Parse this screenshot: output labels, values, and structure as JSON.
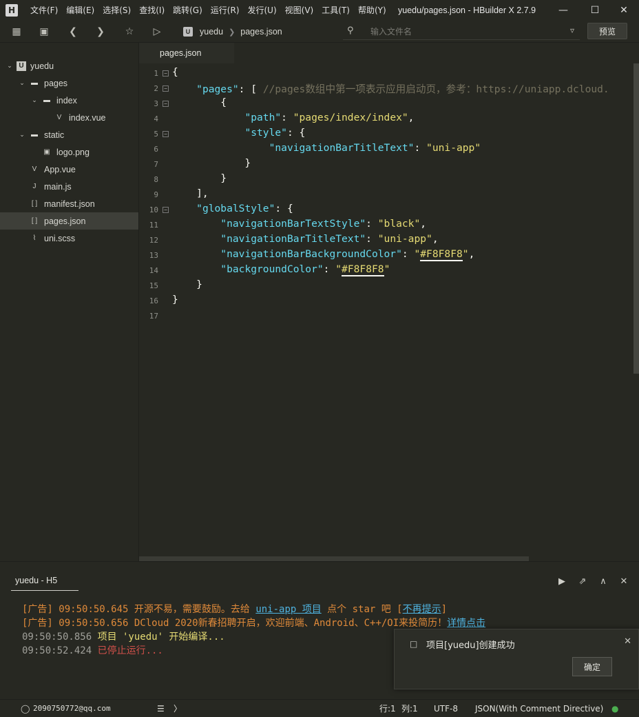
{
  "app": {
    "logo_letter": "H",
    "window_title": "yuedu/pages.json - HBuilder X 2.7.9",
    "menu": [
      "文件(F)",
      "编辑(E)",
      "选择(S)",
      "查找(I)",
      "跳转(G)",
      "运行(R)",
      "发行(U)",
      "视图(V)",
      "工具(T)",
      "帮助(Y)"
    ]
  },
  "toolbar": {
    "breadcrumb": [
      "yuedu",
      "pages.json"
    ],
    "project_badge": "U",
    "search_placeholder": "输入文件名",
    "preview_label": "预览"
  },
  "sidebar": {
    "tree": [
      {
        "label": "yuedu",
        "icon": "project-icon",
        "twisty": "open",
        "selected": false
      },
      {
        "label": "pages",
        "icon": "folder-icon",
        "twisty": "open",
        "selected": false
      },
      {
        "label": "index",
        "icon": "folder-icon",
        "twisty": "open",
        "selected": false
      },
      {
        "label": "index.vue",
        "icon": "vue-file-icon",
        "twisty": "none",
        "selected": false
      },
      {
        "label": "static",
        "icon": "folder-icon",
        "twisty": "open",
        "selected": false
      },
      {
        "label": "logo.png",
        "icon": "image-file-icon",
        "twisty": "none",
        "selected": false
      },
      {
        "label": "App.vue",
        "icon": "vue-file-icon",
        "twisty": "none",
        "selected": false
      },
      {
        "label": "main.js",
        "icon": "js-file-icon",
        "twisty": "none",
        "selected": false
      },
      {
        "label": "manifest.json",
        "icon": "json-file-icon",
        "twisty": "none",
        "selected": false
      },
      {
        "label": "pages.json",
        "icon": "json-file-icon",
        "twisty": "none",
        "selected": true
      },
      {
        "label": "uni.scss",
        "icon": "scss-file-icon",
        "twisty": "none",
        "selected": false
      }
    ]
  },
  "editor": {
    "tab_label": "pages.json",
    "lines": [
      [
        {
          "t": "{",
          "c": "p"
        }
      ],
      [
        {
          "t": "    ",
          "c": "p"
        },
        {
          "t": "\"pages\"",
          "c": "k"
        },
        {
          "t": ": [ ",
          "c": "p"
        },
        {
          "t": "//pages数组中第一项表示应用启动页，参考：https://uniapp.dcloud.",
          "c": "c"
        }
      ],
      [
        {
          "t": "        {",
          "c": "p"
        }
      ],
      [
        {
          "t": "            ",
          "c": "p"
        },
        {
          "t": "\"path\"",
          "c": "k"
        },
        {
          "t": ": ",
          "c": "p"
        },
        {
          "t": "\"pages/index/index\"",
          "c": "s"
        },
        {
          "t": ",",
          "c": "p"
        }
      ],
      [
        {
          "t": "            ",
          "c": "p"
        },
        {
          "t": "\"style\"",
          "c": "k"
        },
        {
          "t": ": {",
          "c": "p"
        }
      ],
      [
        {
          "t": "                ",
          "c": "p"
        },
        {
          "t": "\"navigationBarTitleText\"",
          "c": "k"
        },
        {
          "t": ": ",
          "c": "p"
        },
        {
          "t": "\"uni-app\"",
          "c": "s"
        }
      ],
      [
        {
          "t": "            }",
          "c": "p"
        }
      ],
      [
        {
          "t": "        }",
          "c": "p"
        }
      ],
      [
        {
          "t": "    ],",
          "c": "p"
        }
      ],
      [
        {
          "t": "    ",
          "c": "p"
        },
        {
          "t": "\"globalStyle\"",
          "c": "k"
        },
        {
          "t": ": {",
          "c": "p"
        }
      ],
      [
        {
          "t": "        ",
          "c": "p"
        },
        {
          "t": "\"navigationBarTextStyle\"",
          "c": "k"
        },
        {
          "t": ": ",
          "c": "p"
        },
        {
          "t": "\"black\"",
          "c": "s"
        },
        {
          "t": ",",
          "c": "p"
        }
      ],
      [
        {
          "t": "        ",
          "c": "p"
        },
        {
          "t": "\"navigationBarTitleText\"",
          "c": "k"
        },
        {
          "t": ": ",
          "c": "p"
        },
        {
          "t": "\"uni-app\"",
          "c": "s"
        },
        {
          "t": ",",
          "c": "p"
        }
      ],
      [
        {
          "t": "        ",
          "c": "p"
        },
        {
          "t": "\"navigationBarBackgroundColor\"",
          "c": "k"
        },
        {
          "t": ": ",
          "c": "p"
        },
        {
          "t": "\"",
          "c": "s"
        },
        {
          "t": "#F8F8F8",
          "c": "s hl"
        },
        {
          "t": "\"",
          "c": "s"
        },
        {
          "t": ",",
          "c": "p"
        }
      ],
      [
        {
          "t": "        ",
          "c": "p"
        },
        {
          "t": "\"backgroundColor\"",
          "c": "k"
        },
        {
          "t": ": ",
          "c": "p"
        },
        {
          "t": "\"",
          "c": "s"
        },
        {
          "t": "#F8F8F8",
          "c": "s hl"
        },
        {
          "t": "\"",
          "c": "s"
        }
      ],
      [
        {
          "t": "    }",
          "c": "p"
        }
      ],
      [
        {
          "t": "}",
          "c": "p"
        }
      ],
      [
        {
          "t": "",
          "c": "p"
        }
      ]
    ],
    "folds": [
      1,
      2,
      3,
      5,
      10
    ]
  },
  "console": {
    "tab_label": "yuedu - H5",
    "lines": [
      [
        {
          "t": "[广告] ",
          "c": "ad"
        },
        {
          "t": "09:50:50.645 ",
          "c": "ad"
        },
        {
          "t": "开源不易，需要鼓励。去给 ",
          "c": "ad"
        },
        {
          "t": "uni-app 项目",
          "c": "link"
        },
        {
          "t": " 点个 star 吧 [",
          "c": "ad"
        },
        {
          "t": "不再提示",
          "c": "link"
        },
        {
          "t": "]",
          "c": "ad"
        }
      ],
      [
        {
          "t": "[广告] ",
          "c": "ad"
        },
        {
          "t": "09:50:50.656 ",
          "c": "ad"
        },
        {
          "t": "DCloud 2020新春招聘开启，欢迎前端、Android、C++/OI来投简历！",
          "c": "ad"
        },
        {
          "t": "详情点击",
          "c": "link"
        }
      ],
      [
        {
          "t": "09:50:50.856 ",
          "c": "con"
        },
        {
          "t": "项目 'yuedu' 开始编译...",
          "c": "ok"
        }
      ],
      [
        {
          "t": "09:50:52.424 ",
          "c": "con"
        },
        {
          "t": "已停止运行...",
          "c": "stop"
        }
      ]
    ]
  },
  "toast": {
    "message": "项目[yuedu]创建成功",
    "ok_label": "确定"
  },
  "status": {
    "account": "2090750772@qq.com",
    "line": "行:1",
    "col": "列:1",
    "encoding": "UTF-8",
    "language": "JSON(With Comment Directive)"
  },
  "colors": {
    "background": "#272822",
    "keyword": "#66d9ef",
    "string": "#e6db74",
    "comment": "#75715e",
    "ad": "#e08a3a",
    "stop": "#d0504a",
    "link": "#4fb3e0"
  }
}
